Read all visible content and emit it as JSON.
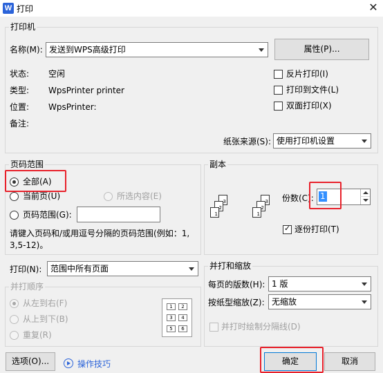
{
  "window": {
    "title": "打印",
    "app_icon_letter": "W"
  },
  "printer": {
    "group_label": "打印机",
    "name_label": "名称(M):",
    "name_value": "发送到WPS高级打印",
    "properties_button": "属性(P)...",
    "status_label": "状态:",
    "status_value": "空闲",
    "type_label": "类型:",
    "type_value": "WpsPrinter printer",
    "location_label": "位置:",
    "location_value": "WpsPrinter:",
    "comment_label": "备注:",
    "options": [
      {
        "label": "反片打印(I)",
        "checked": false
      },
      {
        "label": "打印到文件(L)",
        "checked": false
      },
      {
        "label": "双面打印(X)",
        "checked": false
      }
    ],
    "paper_source_label": "纸张来源(S):",
    "paper_source_value": "使用打印机设置"
  },
  "page_range": {
    "group_label": "页码范围",
    "all": "全部(A)",
    "current": "当前页(U)",
    "selection": "所选内容(E)",
    "pages": "页码范围(G):",
    "pages_value": "",
    "hint": "请键入页码和/或用逗号分隔的页码范围(例如：1,3,5-12)。",
    "selected": "all"
  },
  "print_what": {
    "label": "打印(N):",
    "value": "范围中所有页面"
  },
  "collate_order": {
    "group_label": "并打顺序",
    "left_to_right": "从左到右(F)",
    "top_to_bottom": "从上到下(B)",
    "repeat": "重复(R)",
    "preview_numbers": [
      "1",
      "2",
      "3",
      "4",
      "5",
      "6"
    ]
  },
  "copies": {
    "group_label": "副本",
    "count_label": "份数(C):",
    "count_value": "1",
    "collate_label": "逐份打印(T)",
    "collate_checked": true,
    "page_numbers": [
      "1",
      "2",
      "3"
    ]
  },
  "zoom": {
    "group_label": "并打和缩放",
    "pages_per_sheet_label": "每页的版数(H):",
    "pages_per_sheet_value": "1 版",
    "scale_label": "按纸型缩放(Z):",
    "scale_value": "无缩放",
    "draw_lines_label": "并打时绘制分隔线(D)"
  },
  "footer": {
    "options_button": "选项(O)...",
    "tips_link": "操作技巧",
    "ok_button": "确定",
    "cancel_button": "取消"
  },
  "colors": {
    "highlight_red": "#e8202a",
    "link_blue": "#2b63d9",
    "selection_blue": "#3390ff"
  }
}
